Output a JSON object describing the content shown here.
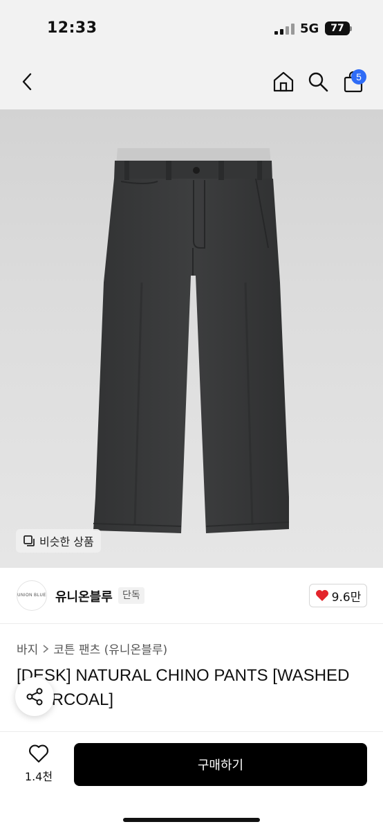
{
  "status_bar": {
    "time": "12:33",
    "network": "5G",
    "battery": "77"
  },
  "header": {
    "cart_count": "5"
  },
  "product_image": {
    "similar_label": "비슷한 상품"
  },
  "brand": {
    "name": "유니온블루",
    "logo_text": "UNION BLUE",
    "tag": "단독",
    "likes": "9.6만"
  },
  "breadcrumb": {
    "category": "바지",
    "subcategory": "코튼 팬츠 (유니온블루)"
  },
  "product": {
    "title": "[DESK] NATURAL CHINO PANTS [WASHED CHARCOAL]"
  },
  "bottom_bar": {
    "wish_count": "1.4천",
    "buy_label": "구매하기"
  },
  "colors": {
    "accent_blue": "#2f6cf6",
    "heart_red": "#e3242b",
    "button_black": "#000000"
  }
}
